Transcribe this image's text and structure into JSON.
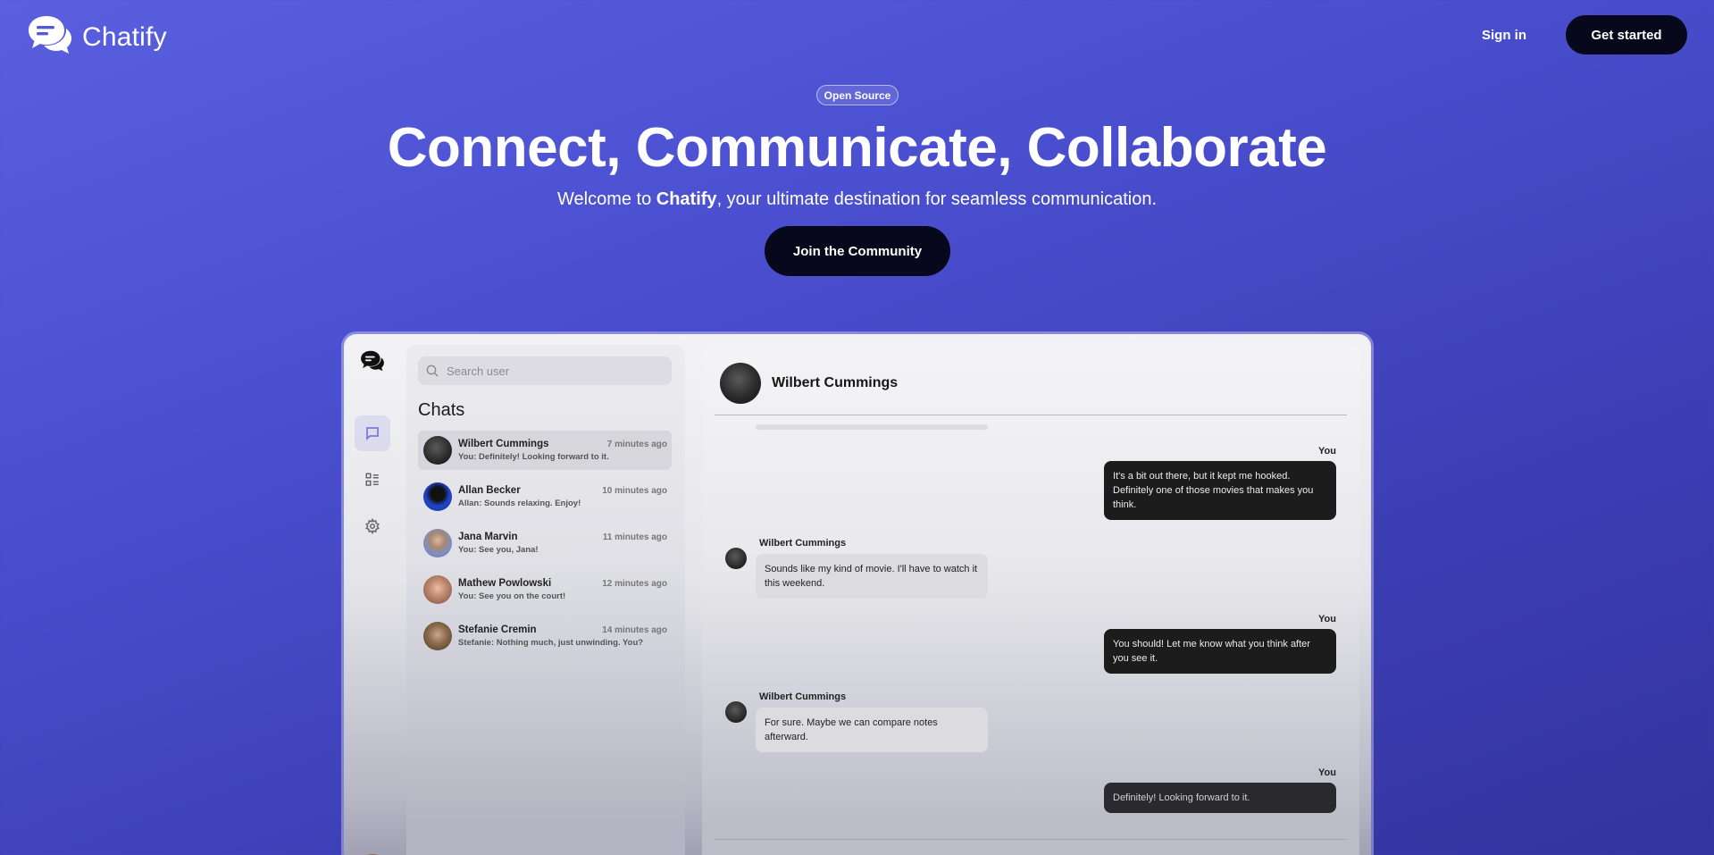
{
  "header": {
    "brand": "Chatify",
    "sign_in": "Sign in",
    "get_started": "Get started"
  },
  "hero": {
    "badge": "Open Source",
    "title": "Connect, Communicate, Collaborate",
    "subtitle_prefix": "Welcome to ",
    "subtitle_brand": "Chatify",
    "subtitle_suffix": ", your ultimate destination for seamless communication.",
    "cta": "Join the Community"
  },
  "app": {
    "sidebar_icons": [
      "chat-logo-icon",
      "message-icon",
      "list-icon",
      "gear-icon"
    ],
    "search": {
      "placeholder": "Search user"
    },
    "chats_title": "Chats",
    "chats": [
      {
        "name": "Wilbert Cummings",
        "time": "7 minutes ago",
        "preview": "You: Definitely! Looking forward to it.",
        "avatar_color": "#2b2b2b"
      },
      {
        "name": "Allan Becker",
        "time": "10 minutes ago",
        "preview": "Allan: Sounds relaxing. Enjoy!",
        "avatar_color": "#1b3aa8"
      },
      {
        "name": "Jana Marvin",
        "time": "11 minutes ago",
        "preview": "You: See you, Jana!",
        "avatar_color": "#7f8fc0"
      },
      {
        "name": "Mathew Powlowski",
        "time": "12 minutes ago",
        "preview": "You: See you on the court!",
        "avatar_color": "#a67560"
      },
      {
        "name": "Stefanie Cremin",
        "time": "14 minutes ago",
        "preview": "Stefanie: Nothing much, just unwinding. You?",
        "avatar_color": "#7a6548"
      }
    ],
    "conversation": {
      "contact": "Wilbert Cummings",
      "messages": [
        {
          "from": "You",
          "text": "It's a bit out there, but it kept me hooked. Definitely one of those movies that makes you think."
        },
        {
          "from": "Wilbert Cummings",
          "text": "Sounds like my kind of movie. I'll have to watch it this weekend."
        },
        {
          "from": "You",
          "text": "You should! Let me know what you think after you see it."
        },
        {
          "from": "Wilbert Cummings",
          "text": "For sure. Maybe we can compare notes afterward."
        },
        {
          "from": "You",
          "text": "Definitely! Looking forward to it."
        }
      ]
    }
  }
}
